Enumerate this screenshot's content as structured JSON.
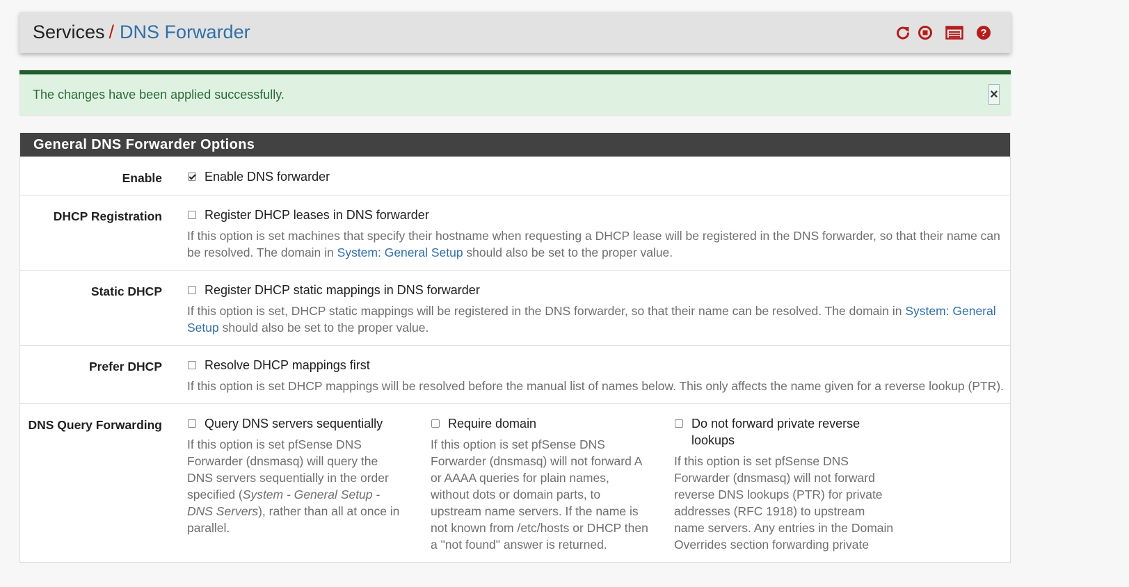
{
  "breadcrumb": {
    "parent": "Services",
    "separator": "/",
    "current": "DNS Forwarder"
  },
  "header_icons": [
    "reload-icon",
    "stop-icon",
    "log-icon",
    "help-icon"
  ],
  "alert": {
    "message": "The changes have been applied successfully.",
    "close_label": "×"
  },
  "panel": {
    "title": "General DNS Forwarder Options",
    "rows": {
      "enable": {
        "label": "Enable",
        "checkbox_label": "Enable DNS forwarder",
        "checked": true
      },
      "dhcp_registration": {
        "label": "DHCP Registration",
        "checkbox_label": "Register DHCP leases in DNS forwarder",
        "checked": false,
        "help_before": "If this option is set machines that specify their hostname when requesting a DHCP lease will be registered in the DNS forwarder, so that their name can be resolved. The domain in ",
        "help_link": "System: General Setup",
        "help_after": " should also be set to the proper value."
      },
      "static_dhcp": {
        "label": "Static DHCP",
        "checkbox_label": "Register DHCP static mappings in DNS forwarder",
        "checked": false,
        "help_before": "If this option is set, DHCP static mappings will be registered in the DNS forwarder, so that their name can be resolved. The domain in ",
        "help_link": "System: General Setup",
        "help_after": " should also be set to the proper value."
      },
      "prefer_dhcp": {
        "label": "Prefer DHCP",
        "checkbox_label": "Resolve DHCP mappings first",
        "checked": false,
        "help": "If this option is set DHCP mappings will be resolved before the manual list of names below. This only affects the name given for a reverse lookup (PTR)."
      },
      "dns_query_forwarding": {
        "label": "DNS Query Forwarding",
        "sequential": {
          "checkbox_label": "Query DNS servers sequentially",
          "checked": false,
          "help_before": "If this option is set pfSense DNS Forwarder (dnsmasq) will query the DNS servers sequentially in the order specified (",
          "help_em": "System - General Setup - DNS Servers",
          "help_after": "), rather than all at once in parallel."
        },
        "require_domain": {
          "checkbox_label": "Require domain",
          "checked": false,
          "help": "If this option is set pfSense DNS Forwarder (dnsmasq) will not forward A or AAAA queries for plain names, without dots or domain parts, to upstream name servers. If the name is not known from /etc/hosts or DHCP then a \"not found\" answer is returned."
        },
        "no_private_reverse": {
          "checkbox_label": "Do not forward private reverse lookups",
          "checked": false,
          "help": "If this option is set pfSense DNS Forwarder (dnsmasq) will not forward reverse DNS lookups (PTR) for private addresses (RFC 1918) to upstream name servers. Any entries in the Domain Overrides section forwarding private"
        }
      }
    }
  },
  "colors": {
    "header_bg": "#e2e2e2",
    "link_blue": "#2f6fa8",
    "icon_red": "#b71c1c",
    "alert_border": "#1e5c2c",
    "alert_bg": "#dff2e2",
    "panel_head_bg": "#424242"
  }
}
